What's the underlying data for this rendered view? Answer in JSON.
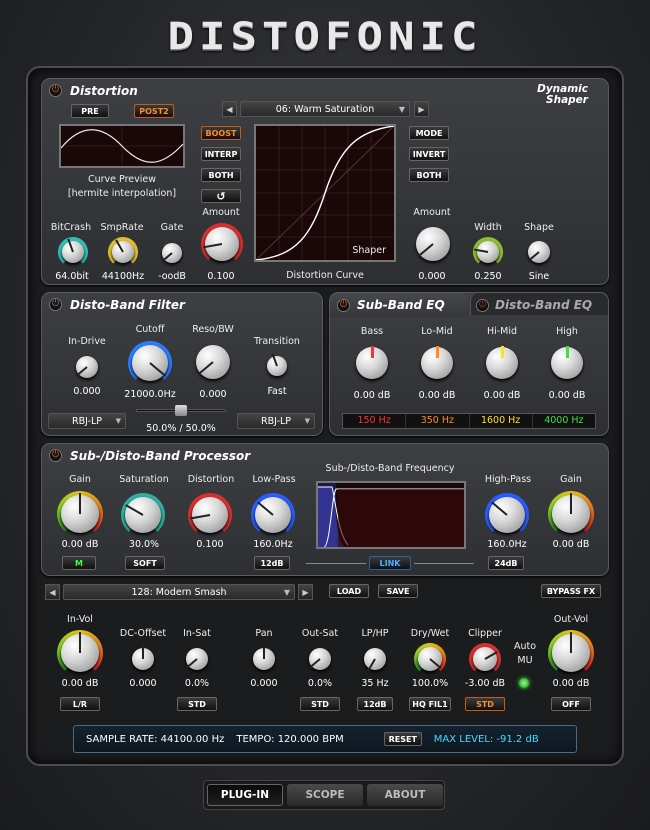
{
  "app": {
    "logo": "DISTOFONIC"
  },
  "distortion": {
    "title": "Distortion",
    "pre": "PRE",
    "post2": "POST2",
    "curve_preview_label": "Curve Preview",
    "interp_label": "[hermite interpolation]",
    "dynamic_shaper": "Dynamic Shaper",
    "preset": "06: Warm Saturation",
    "boost": "BOOST",
    "interp": "INTERP",
    "both1": "BOTH",
    "reset_glyph": "↺",
    "mode": "MODE",
    "invert": "INVERT",
    "both2": "BOTH",
    "shaper_label": "Shaper",
    "curve_label": "Distortion Curve",
    "knobs": [
      {
        "id": "bitcrash",
        "label": "BitCrash",
        "value": "64.0bit"
      },
      {
        "id": "smprate",
        "label": "SmpRate",
        "value": "44100Hz"
      },
      {
        "id": "gate",
        "label": "Gate",
        "value": "-oodB"
      },
      {
        "id": "amount1",
        "label": "Amount",
        "value": "0.100"
      },
      {
        "id": "amount2",
        "label": "Amount",
        "value": "0.000"
      },
      {
        "id": "width",
        "label": "Width",
        "value": "0.250"
      },
      {
        "id": "shape",
        "label": "Shape",
        "value": "Sine"
      }
    ]
  },
  "band_filter": {
    "title": "Disto-Band Filter",
    "indrive_label": "In-Drive",
    "indrive_value": "0.000",
    "cutoff_label": "Cutoff",
    "cutoff_value": "21000.0Hz",
    "resobw_label": "Reso/BW",
    "resobw_value": "0.000",
    "transition_label": "Transition",
    "transition_value": "Fast",
    "filter1": "RBJ-LP",
    "filter2": "RBJ-LP",
    "balance": "50.0% / 50.0%"
  },
  "eq": {
    "tab_sub": "Sub-Band EQ",
    "tab_disto": "Disto-Band EQ",
    "bands": [
      {
        "label": "Bass",
        "value": "0.00 dB",
        "freq": "150 Hz",
        "color": "#ff3030"
      },
      {
        "label": "Lo-Mid",
        "value": "0.00 dB",
        "freq": "350 Hz",
        "color": "#ff8a20"
      },
      {
        "label": "Hi-Mid",
        "value": "0.00 dB",
        "freq": "1600 Hz",
        "color": "#ffe020"
      },
      {
        "label": "High",
        "value": "0.00 dB",
        "freq": "4000 Hz",
        "color": "#40e040"
      }
    ]
  },
  "processor": {
    "title": "Sub-/Disto-Band Processor",
    "gain_label": "Gain",
    "gain_value": "0.00 dB",
    "m_btn": "M",
    "sat_label": "Saturation",
    "sat_value": "30.0%",
    "soft_btn": "SOFT",
    "dist_label": "Distortion",
    "dist_value": "0.100",
    "lp_label": "Low-Pass",
    "lp_value": "160.0Hz",
    "lp_btn": "12dB",
    "freq_label": "Sub-/Disto-Band Frequency",
    "link_btn": "LINK",
    "hp_label": "High-Pass",
    "hp_value": "160.0Hz",
    "hp_btn": "24dB",
    "gain2_label": "Gain",
    "gain2_value": "0.00 dB"
  },
  "preset_bar": {
    "preset": "128: Modern Smash",
    "load": "LOAD",
    "save": "SAVE",
    "bypass": "BYPASS FX"
  },
  "master": {
    "knobs": [
      {
        "label": "In-Vol",
        "value": "0.00 dB"
      },
      {
        "label": "DC-Offset",
        "value": "0.000"
      },
      {
        "label": "In-Sat",
        "value": "0.0%"
      },
      {
        "label": "Pan",
        "value": "0.000"
      },
      {
        "label": "Out-Sat",
        "value": "0.0%"
      },
      {
        "label": "LP/HP",
        "value": "35 Hz"
      },
      {
        "label": "Dry/Wet",
        "value": "100.0%"
      },
      {
        "label": "Clipper",
        "value": "-3.00 dB"
      },
      {
        "label": "Out-Vol",
        "value": "0.00 dB"
      }
    ],
    "auto_mu": "Auto MU",
    "lr_btn": "L/R",
    "std1": "STD",
    "std2": "STD",
    "db12": "12dB",
    "hqfil": "HQ FIL1",
    "std3": "STD",
    "off_btn": "OFF"
  },
  "status": {
    "sample_rate": "SAMPLE RATE: 44100.00 Hz",
    "tempo": "TEMPO: 120.000 BPM",
    "reset": "RESET",
    "max_level": "MAX LEVEL: -91.2 dB"
  },
  "tabs": {
    "plugin": "PLUG-IN",
    "scope": "SCOPE",
    "about": "ABOUT"
  }
}
